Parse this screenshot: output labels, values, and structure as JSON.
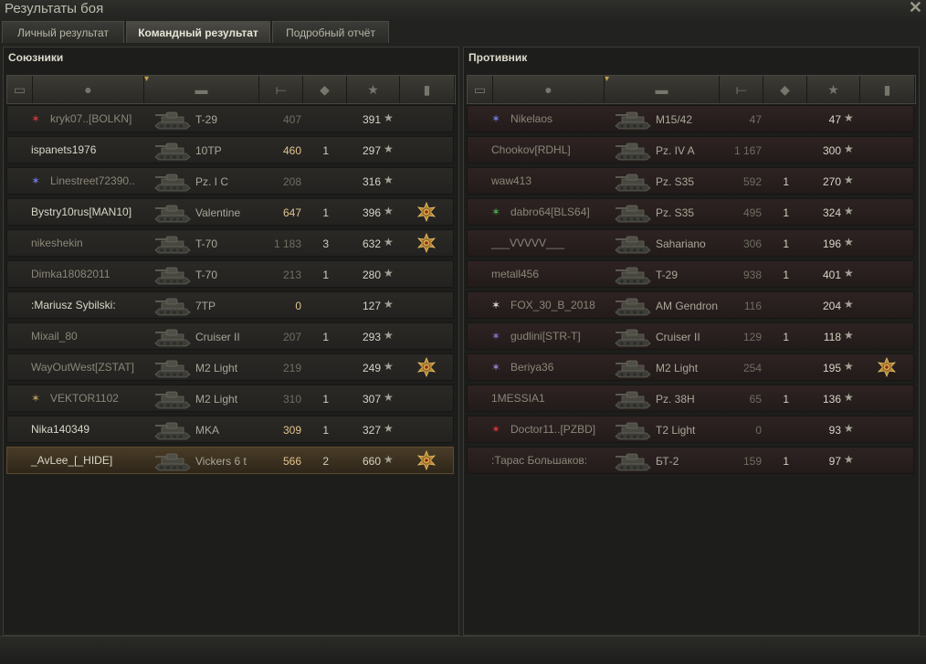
{
  "window": {
    "title": "Результаты боя",
    "close_icon": "close-icon"
  },
  "tabs": [
    {
      "label": "Личный результат",
      "active": false
    },
    {
      "label": "Командный результат",
      "active": true
    },
    {
      "label": "Подробный отчёт",
      "active": false
    }
  ],
  "colors": {
    "dim_text": "#8a8678",
    "bright_text": "#d9d7c8",
    "damage_highlight": "#e2c48f",
    "enemy_row": "#2a2120",
    "own_row": "#4a3c27"
  },
  "columns": [
    {
      "name": "squad-column-icon",
      "icon": "speech-bubble-icon"
    },
    {
      "name": "player-column-icon",
      "icon": "player-icon",
      "sort_indicator": "triangle-down-icon"
    },
    {
      "name": "vehicle-column-icon",
      "icon": "tank-icon"
    },
    {
      "name": "damage-column-icon",
      "icon": "shell-icon"
    },
    {
      "name": "kills-column-icon",
      "icon": "destroyed-tank-icon"
    },
    {
      "name": "xp-column-icon",
      "icon": "star-icon"
    },
    {
      "name": "medal-column-icon",
      "icon": "medal-icon"
    }
  ],
  "allies": {
    "title": "Союзники",
    "rows": [
      {
        "player": "kryk07..[BOLKN]",
        "badge": "clan-emblem-icon",
        "badge_color": "#c8363a",
        "vehicle": "T-29",
        "damage": "407",
        "kills": "",
        "xp": "391",
        "medal": false,
        "alive": false,
        "me": false,
        "dmg_bright": false
      },
      {
        "player": "ispanets1976",
        "badge": "",
        "badge_color": "",
        "vehicle": "10TP",
        "damage": "460",
        "kills": "1",
        "xp": "297",
        "medal": false,
        "alive": true,
        "me": false,
        "dmg_bright": true
      },
      {
        "player": "Linestreet72390..",
        "badge": "clan-emblem-icon",
        "badge_color": "#6c78d8",
        "vehicle": "Pz. I C",
        "damage": "208",
        "kills": "",
        "xp": "316",
        "medal": false,
        "alive": false,
        "me": false,
        "dmg_bright": false
      },
      {
        "player": "Bystry10rus[MAN10]",
        "badge": "",
        "badge_color": "",
        "vehicle": "Valentine",
        "damage": "647",
        "kills": "1",
        "xp": "396",
        "medal": true,
        "alive": true,
        "me": false,
        "dmg_bright": true
      },
      {
        "player": "nikeshekin",
        "badge": "",
        "badge_color": "",
        "vehicle": "T-70",
        "damage": "1 183",
        "kills": "3",
        "xp": "632",
        "medal": true,
        "alive": false,
        "me": false,
        "dmg_bright": false
      },
      {
        "player": "Dimka18082011",
        "badge": "",
        "badge_color": "",
        "vehicle": "T-70",
        "damage": "213",
        "kills": "1",
        "xp": "280",
        "medal": false,
        "alive": false,
        "me": false,
        "dmg_bright": false
      },
      {
        "player": ":Mariusz Sybilski:",
        "badge": "",
        "badge_color": "",
        "vehicle": "7TP",
        "damage": "0",
        "kills": "",
        "xp": "127",
        "medal": false,
        "alive": true,
        "me": false,
        "dmg_bright": true
      },
      {
        "player": "Mixail_80",
        "badge": "",
        "badge_color": "",
        "vehicle": "Cruiser II",
        "damage": "207",
        "kills": "1",
        "xp": "293",
        "medal": false,
        "alive": false,
        "me": false,
        "dmg_bright": false
      },
      {
        "player": "WayOutWest[ZSTAT]",
        "badge": "",
        "badge_color": "",
        "vehicle": "M2 Light",
        "damage": "219",
        "kills": "",
        "xp": "249",
        "medal": true,
        "alive": false,
        "me": false,
        "dmg_bright": false
      },
      {
        "player": "VEKTOR1102",
        "badge": "clan-emblem-icon",
        "badge_color": "#b59a58",
        "vehicle": "M2 Light",
        "damage": "310",
        "kills": "1",
        "xp": "307",
        "medal": false,
        "alive": false,
        "me": false,
        "dmg_bright": false
      },
      {
        "player": "Nika140349",
        "badge": "",
        "badge_color": "",
        "vehicle": "MKA",
        "damage": "309",
        "kills": "1",
        "xp": "327",
        "medal": false,
        "alive": true,
        "me": false,
        "dmg_bright": true
      },
      {
        "player": "_AvLee_[_HIDE]",
        "badge": "",
        "badge_color": "",
        "vehicle": "Vickers 6 t",
        "damage": "566",
        "kills": "2",
        "xp": "660",
        "medal": true,
        "alive": true,
        "me": true,
        "dmg_bright": true
      }
    ]
  },
  "enemies": {
    "title": "Противник",
    "rows": [
      {
        "player": "Nikelaos",
        "badge": "clan-emblem-icon",
        "badge_color": "#6c78d8",
        "vehicle": "M15/42",
        "damage": "47",
        "kills": "",
        "xp": "47",
        "medal": false,
        "alive": false
      },
      {
        "player": "Chookov[RDHL]",
        "badge": "",
        "badge_color": "",
        "vehicle": "Pz. IV A",
        "damage": "1 167",
        "kills": "",
        "xp": "300",
        "medal": false,
        "alive": false
      },
      {
        "player": "waw413",
        "badge": "",
        "badge_color": "",
        "vehicle": "Pz. S35",
        "damage": "592",
        "kills": "1",
        "xp": "270",
        "medal": false,
        "alive": false
      },
      {
        "player": "dabro64[BLS64]",
        "badge": "clan-emblem-icon",
        "badge_color": "#4aa84a",
        "vehicle": "Pz. S35",
        "damage": "495",
        "kills": "1",
        "xp": "324",
        "medal": false,
        "alive": false
      },
      {
        "player": "___VVVVV___",
        "badge": "",
        "badge_color": "",
        "vehicle": "Sahariano",
        "damage": "306",
        "kills": "1",
        "xp": "196",
        "medal": false,
        "alive": false
      },
      {
        "player": "metall456",
        "badge": "",
        "badge_color": "",
        "vehicle": "T-29",
        "damage": "938",
        "kills": "1",
        "xp": "401",
        "medal": false,
        "alive": false
      },
      {
        "player": "FOX_30_B_2018",
        "badge": "clan-emblem-icon",
        "badge_color": "#d8d8d0",
        "vehicle": "AM Gendron",
        "damage": "116",
        "kills": "",
        "xp": "204",
        "medal": false,
        "alive": false
      },
      {
        "player": "gudlini[STR-T]",
        "badge": "clan-emblem-icon",
        "badge_color": "#7c74c8",
        "vehicle": "Cruiser II",
        "damage": "129",
        "kills": "1",
        "xp": "118",
        "medal": false,
        "alive": false
      },
      {
        "player": "Beriya36",
        "badge": "clan-emblem-icon",
        "badge_color": "#9a7cc8",
        "vehicle": "M2 Light",
        "damage": "254",
        "kills": "",
        "xp": "195",
        "medal": true,
        "alive": false
      },
      {
        "player": "1MESSIA1",
        "badge": "",
        "badge_color": "",
        "vehicle": "Pz. 38H",
        "damage": "65",
        "kills": "1",
        "xp": "136",
        "medal": false,
        "alive": false
      },
      {
        "player": "Doctor11..[PZBD]",
        "badge": "clan-emblem-icon",
        "badge_color": "#d8343a",
        "vehicle": "T2 Light",
        "damage": "0",
        "kills": "",
        "xp": "93",
        "medal": false,
        "alive": false
      },
      {
        "player": ":Тарас Большаков:",
        "badge": "",
        "badge_color": "",
        "vehicle": "БТ-2",
        "damage": "159",
        "kills": "1",
        "xp": "97",
        "medal": false,
        "alive": false
      }
    ]
  }
}
